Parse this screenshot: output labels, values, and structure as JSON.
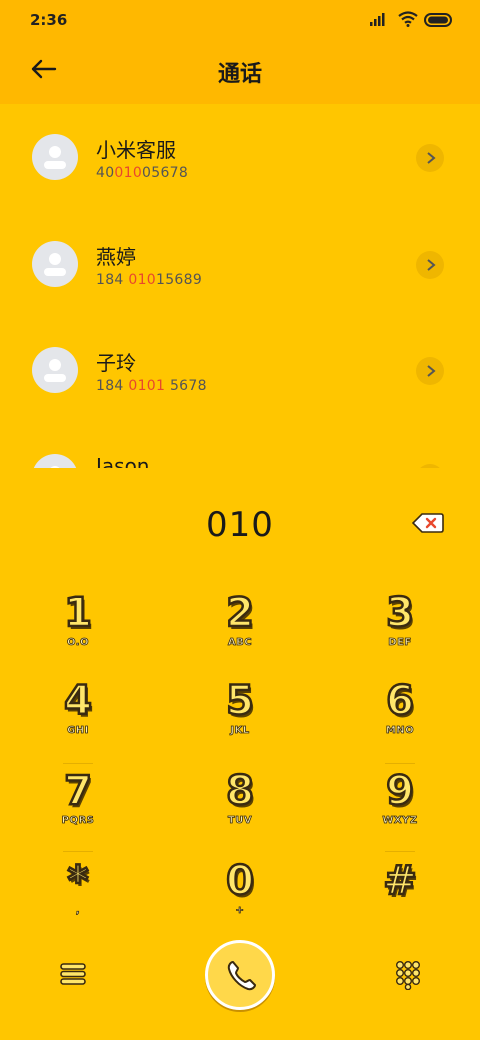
{
  "status": {
    "time": "2:36"
  },
  "header": {
    "title": "通话"
  },
  "contacts": [
    {
      "name": "小米客服",
      "num_pre": "40",
      "num_hl": "010",
      "num_post": "05678"
    },
    {
      "name": "燕婷",
      "num_pre": "184 ",
      "num_hl": "010",
      "num_post": "15689"
    },
    {
      "name": "子玲",
      "num_pre": "184 ",
      "num_hl": "0101",
      "num_post": " 5678"
    },
    {
      "name": "Jason",
      "num_pre": "",
      "num_hl": "",
      "num_post": ""
    }
  ],
  "dialer": {
    "number": "010",
    "keys": [
      {
        "digit": "1",
        "letters": "O.O"
      },
      {
        "digit": "2",
        "letters": "ABC"
      },
      {
        "digit": "3",
        "letters": "DEF"
      },
      {
        "digit": "4",
        "letters": "GHI"
      },
      {
        "digit": "5",
        "letters": "JKL"
      },
      {
        "digit": "6",
        "letters": "MNO"
      },
      {
        "digit": "7",
        "letters": "PQRS"
      },
      {
        "digit": "8",
        "letters": "TUV"
      },
      {
        "digit": "9",
        "letters": "WXYZ"
      },
      {
        "digit": "*",
        "letters": ","
      },
      {
        "digit": "0",
        "letters": "+"
      },
      {
        "digit": "#",
        "letters": ""
      }
    ]
  },
  "colors": {
    "accent": "#FFC600",
    "header": "#FFB800",
    "highlight": "#E8472D"
  },
  "icons": {
    "back": "back-arrow-icon",
    "delete": "backspace-icon",
    "menu": "menu-icon",
    "call": "phone-icon",
    "keypad": "keypad-icon"
  }
}
